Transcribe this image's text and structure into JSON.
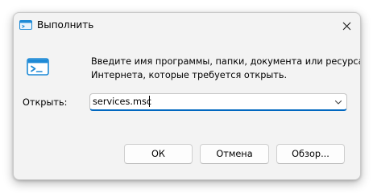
{
  "window": {
    "title": "Выполнить",
    "title_icon": "run-icon",
    "close_icon": "close-icon"
  },
  "body": {
    "big_icon": "run-icon",
    "description_line1": "Введите имя программы, папки, документа или ресурса",
    "description_line2": "Интернета, которые требуется открыть.",
    "open_label": "Открыть:",
    "open_value": "services.msc",
    "dropdown_icon": "chevron-down-icon"
  },
  "buttons": {
    "ok": "ОК",
    "cancel": "Отмена",
    "browse": "Обзор..."
  },
  "colors": {
    "accent": "#0067c0",
    "icon_blue": "#1e8ad6",
    "dialog_bg": "#f3f3f3"
  }
}
